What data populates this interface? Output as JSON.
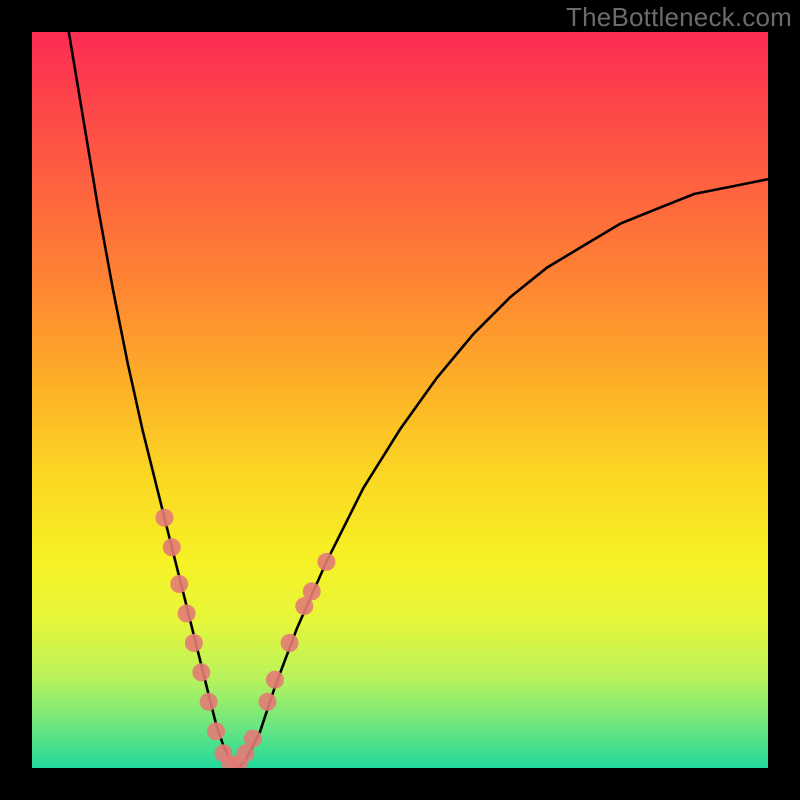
{
  "watermark": "TheBottleneck.com",
  "chart_data": {
    "type": "line",
    "title": "",
    "xlabel": "",
    "ylabel": "",
    "xlim": [
      0,
      100
    ],
    "ylim": [
      0,
      100
    ],
    "grid": false,
    "legend": false,
    "background_gradient": [
      "#fc2c53",
      "#fbd623",
      "#22d99c"
    ],
    "series": [
      {
        "name": "bottleneck-curve",
        "color": "#000000",
        "x": [
          5,
          7,
          9,
          11,
          13,
          15,
          17,
          19,
          20,
          21,
          22,
          23,
          24,
          25,
          26,
          27,
          28,
          29,
          31,
          33,
          36,
          40,
          45,
          50,
          55,
          60,
          65,
          70,
          75,
          80,
          85,
          90,
          95,
          100
        ],
        "y": [
          100,
          88,
          76,
          65,
          55,
          46,
          38,
          30,
          26,
          22,
          18,
          14,
          10,
          6,
          3,
          1,
          0,
          1,
          5,
          11,
          19,
          28,
          38,
          46,
          53,
          59,
          64,
          68,
          71,
          74,
          76,
          78,
          79,
          80
        ]
      }
    ],
    "highlight_points": {
      "name": "sample-dots",
      "color": "#e37b75",
      "points": [
        {
          "x": 18,
          "y": 34
        },
        {
          "x": 19,
          "y": 30
        },
        {
          "x": 20,
          "y": 25
        },
        {
          "x": 21,
          "y": 21
        },
        {
          "x": 22,
          "y": 17
        },
        {
          "x": 23,
          "y": 13
        },
        {
          "x": 24,
          "y": 9
        },
        {
          "x": 25,
          "y": 5
        },
        {
          "x": 26,
          "y": 2
        },
        {
          "x": 27,
          "y": 0.5
        },
        {
          "x": 28,
          "y": 0.5
        },
        {
          "x": 29,
          "y": 2
        },
        {
          "x": 30,
          "y": 4
        },
        {
          "x": 32,
          "y": 9
        },
        {
          "x": 33,
          "y": 12
        },
        {
          "x": 35,
          "y": 17
        },
        {
          "x": 37,
          "y": 22
        },
        {
          "x": 38,
          "y": 24
        },
        {
          "x": 40,
          "y": 28
        }
      ]
    },
    "optimum_x": 27.5
  }
}
